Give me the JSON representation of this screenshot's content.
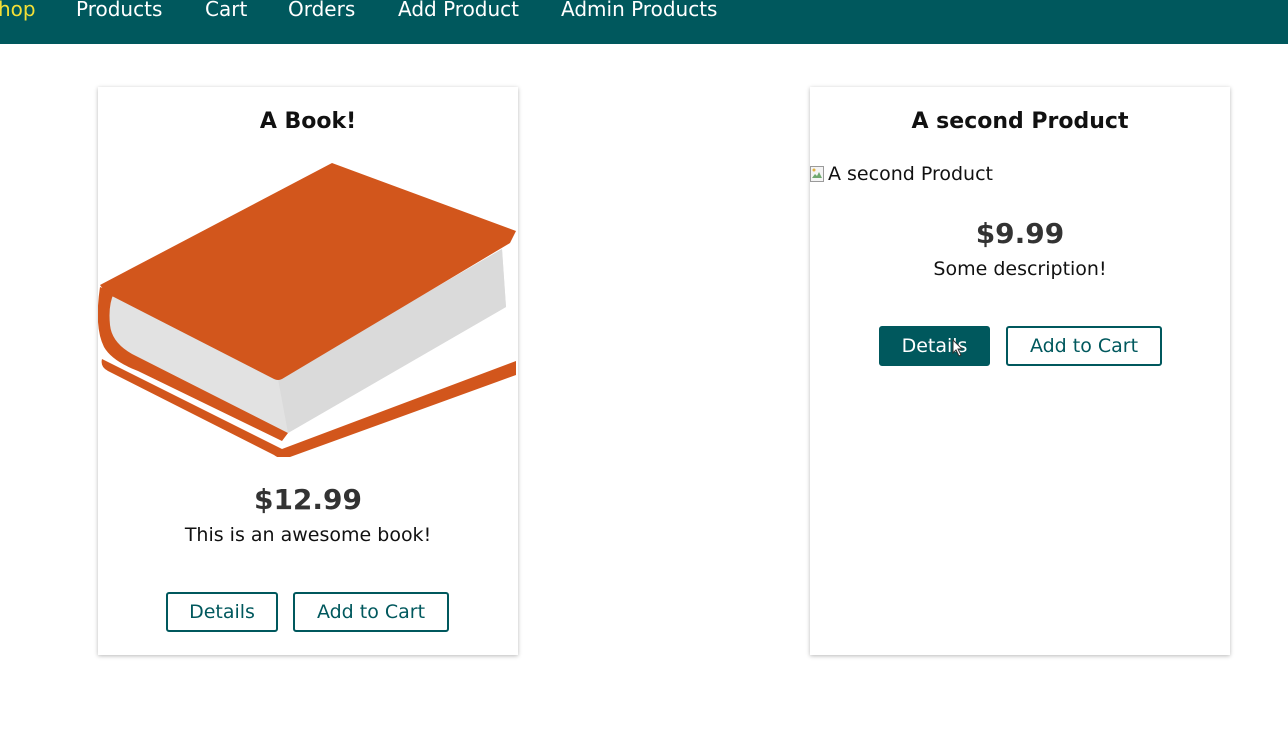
{
  "nav": {
    "items": [
      {
        "label": "hop",
        "active": true
      },
      {
        "label": "Products"
      },
      {
        "label": "Cart"
      },
      {
        "label": "Orders"
      },
      {
        "label": "Add Product"
      },
      {
        "label": "Admin Products"
      }
    ]
  },
  "products": [
    {
      "title": "A Book!",
      "image_icon": "book-image",
      "price": "$12.99",
      "description": "This is an awesome book!",
      "details_label": "Details",
      "add_to_cart_label": "Add to Cart"
    },
    {
      "title": "A second Product",
      "image_alt": "A second Product",
      "price": "$9.99",
      "description": "Some description!",
      "details_label": "Details",
      "add_to_cart_label": "Add to Cart"
    }
  ],
  "colors": {
    "brand": "#00585d",
    "active_nav": "#f3df36",
    "book_cover": "#d2561c",
    "book_pages": "#e2e2e2"
  }
}
